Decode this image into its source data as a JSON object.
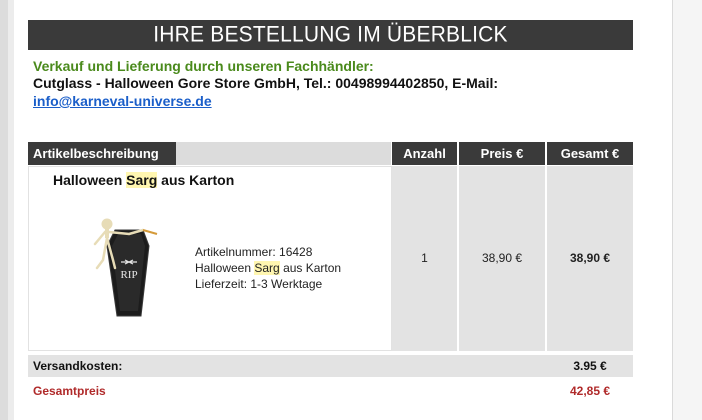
{
  "banner": {
    "title": "IHRE BESTELLUNG IM ÜBERBLICK"
  },
  "vendor": {
    "title": "Verkauf und Lieferung durch unseren Fachhändler:",
    "info": "Cutglass - Halloween Gore Store GmbH, Tel.: 00498994402850, E-Mail:",
    "email": "info@karneval-universe.de"
  },
  "table": {
    "headers": {
      "description": "Artikelbeschreibung",
      "quantity": "Anzahl",
      "price": "Preis €",
      "total": "Gesamt €"
    },
    "item": {
      "name_pre": "Halloween ",
      "name_highlight": "Sarg",
      "name_post": " aus Karton",
      "image_icon": "coffin-skeleton-image",
      "article_number": "Artikelnummer: 16428",
      "detail_name_pre": "Halloween ",
      "detail_name_highlight": "Sarg",
      "detail_name_post": " aus Karton",
      "delivery": "Lieferzeit: 1-3 Werktage",
      "quantity": "1",
      "price": "38,90 €",
      "total": "38,90 €"
    }
  },
  "shipping": {
    "label": "Versandkosten:",
    "value": "3.95 €"
  },
  "grand_total": {
    "label": "Gesamtpreis",
    "value": "42,85 €"
  },
  "colors": {
    "banner_bg": "#3a3a3a",
    "vendor_title": "#4a8a1c",
    "email_link": "#1a5ec9",
    "total_red": "#b02a2a",
    "highlight": "#fff6b0"
  }
}
